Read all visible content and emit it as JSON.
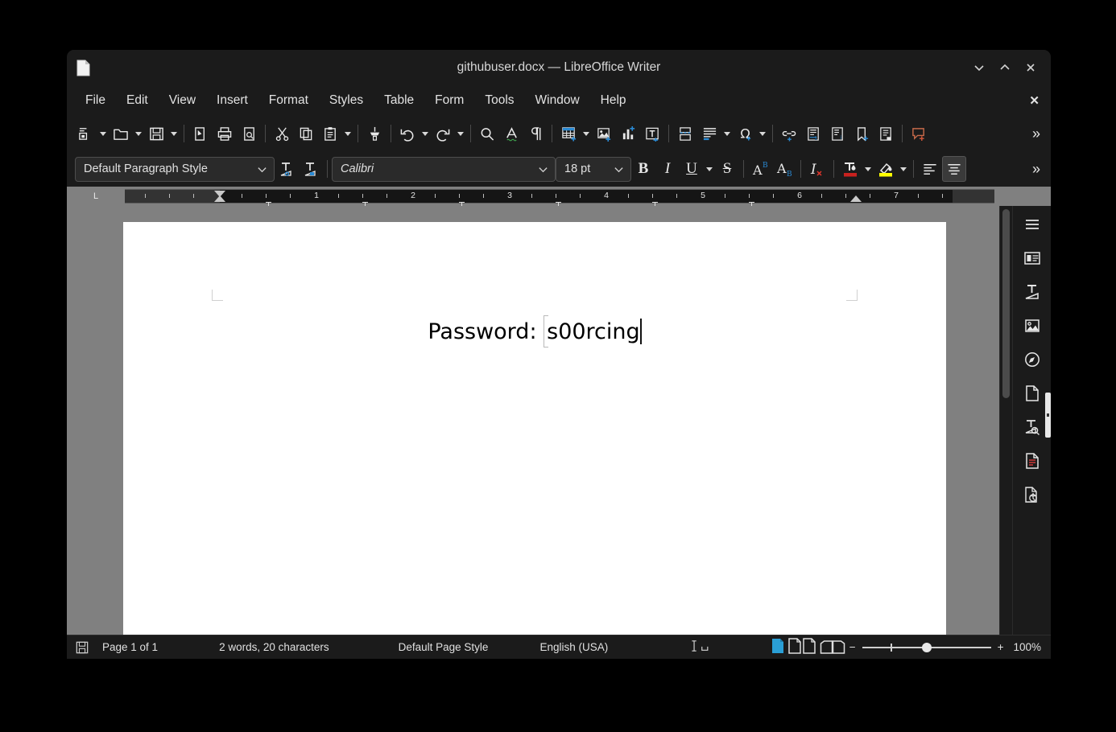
{
  "window": {
    "title": "githubuser.docx — LibreOffice Writer",
    "doc_icon": "document-icon",
    "controls": {
      "minimize": "minimize-icon",
      "maximize": "maximize-icon",
      "close": "close-icon"
    }
  },
  "menubar": {
    "items": [
      {
        "label": "File"
      },
      {
        "label": "Edit"
      },
      {
        "label": "View"
      },
      {
        "label": "Insert"
      },
      {
        "label": "Format"
      },
      {
        "label": "Styles"
      },
      {
        "label": "Table"
      },
      {
        "label": "Form"
      },
      {
        "label": "Tools"
      },
      {
        "label": "Window"
      },
      {
        "label": "Help"
      }
    ],
    "close_document": "✕"
  },
  "standard_toolbar": {
    "overflow_label": "»",
    "items": [
      {
        "name": "new-document-icon",
        "dropdown": true
      },
      {
        "name": "open-folder-icon",
        "dropdown": true
      },
      {
        "name": "save-icon",
        "dropdown": true
      },
      {
        "sep": true
      },
      {
        "name": "export-pdf-icon"
      },
      {
        "name": "print-icon"
      },
      {
        "name": "print-preview-icon"
      },
      {
        "sep": true
      },
      {
        "name": "cut-scissors-icon"
      },
      {
        "name": "copy-icon"
      },
      {
        "name": "paste-clipboard-icon",
        "dropdown": true
      },
      {
        "sep": true
      },
      {
        "name": "clone-formatting-paintbrush-icon"
      },
      {
        "sep": true
      },
      {
        "name": "undo-icon",
        "dropdown": true
      },
      {
        "name": "redo-icon",
        "dropdown": true
      },
      {
        "sep": true
      },
      {
        "name": "find-replace-magnifier-icon"
      },
      {
        "name": "spelling-check-icon"
      },
      {
        "name": "formatting-marks-pilcrow-icon"
      },
      {
        "sep": true
      },
      {
        "name": "insert-table-icon",
        "dropdown": true
      },
      {
        "name": "insert-image-icon"
      },
      {
        "name": "insert-chart-icon"
      },
      {
        "name": "insert-text-box-icon"
      },
      {
        "sep": true
      },
      {
        "name": "insert-page-break-icon"
      },
      {
        "name": "insert-field-icon",
        "dropdown": true
      },
      {
        "name": "insert-special-character-omega-icon",
        "dropdown": true
      },
      {
        "sep": true
      },
      {
        "name": "insert-hyperlink-icon"
      },
      {
        "name": "insert-footnote-icon"
      },
      {
        "name": "insert-endnote-icon"
      },
      {
        "name": "insert-bookmark-icon"
      },
      {
        "name": "insert-cross-reference-icon"
      },
      {
        "sep": true
      },
      {
        "name": "insert-comment-icon"
      }
    ]
  },
  "formatting_toolbar": {
    "paragraph_style": "Default Paragraph Style",
    "font_name": "Calibri",
    "font_size": "18 pt",
    "overflow_label": "»",
    "items": [
      {
        "name": "update-selected-style-icon"
      },
      {
        "name": "new-style-from-selection-icon"
      },
      {
        "name": "bold-button",
        "glyph": "B"
      },
      {
        "name": "italic-button",
        "glyph": "I"
      },
      {
        "name": "underline-button",
        "glyph": "U",
        "dropdown": true
      },
      {
        "name": "strikethrough-button",
        "glyph": "S"
      },
      {
        "name": "superscript-button"
      },
      {
        "name": "subscript-button"
      },
      {
        "name": "clear-formatting-button"
      },
      {
        "name": "font-color-button",
        "color": "#c9211e",
        "dropdown": true
      },
      {
        "name": "highlight-color-button",
        "color": "#ffff00",
        "dropdown": true
      },
      {
        "name": "align-left-button"
      },
      {
        "name": "align-center-button",
        "active": true
      }
    ]
  },
  "ruler": {
    "unit_corner": "L",
    "numbers": [
      "1",
      "2",
      "3",
      "4",
      "5",
      "6",
      "7"
    ]
  },
  "document": {
    "label": "Password: ",
    "value": "s00rcing"
  },
  "sidebar": {
    "items": [
      {
        "name": "sidebar-settings-hamburger-icon"
      },
      {
        "name": "sidebar-properties-icon"
      },
      {
        "name": "sidebar-style-inspector-icon"
      },
      {
        "name": "sidebar-gallery-icon"
      },
      {
        "name": "sidebar-navigator-icon"
      },
      {
        "name": "sidebar-page-icon"
      },
      {
        "name": "sidebar-style-presets-icon"
      },
      {
        "name": "sidebar-manage-changes-icon"
      },
      {
        "name": "sidebar-accessibility-check-icon"
      }
    ]
  },
  "statusbar": {
    "save_icon": "save-status-icon",
    "page": "Page 1 of 1",
    "words": "2 words, 20 characters",
    "page_style": "Default Page Style",
    "language": "English (USA)",
    "selection_mode": "text-selection-icon",
    "view_single": "single-page-view-icon",
    "view_multi": "multi-page-view-icon",
    "view_book": "book-view-icon",
    "zoom_out": "−",
    "zoom_in": "+",
    "zoom_level": "100%"
  },
  "colors": {
    "accent": "#2a8ad4",
    "chrome": "#1b1b1b",
    "canvas": "#808080",
    "font_color": "#c9211e",
    "highlight_color": "#ffff00"
  }
}
